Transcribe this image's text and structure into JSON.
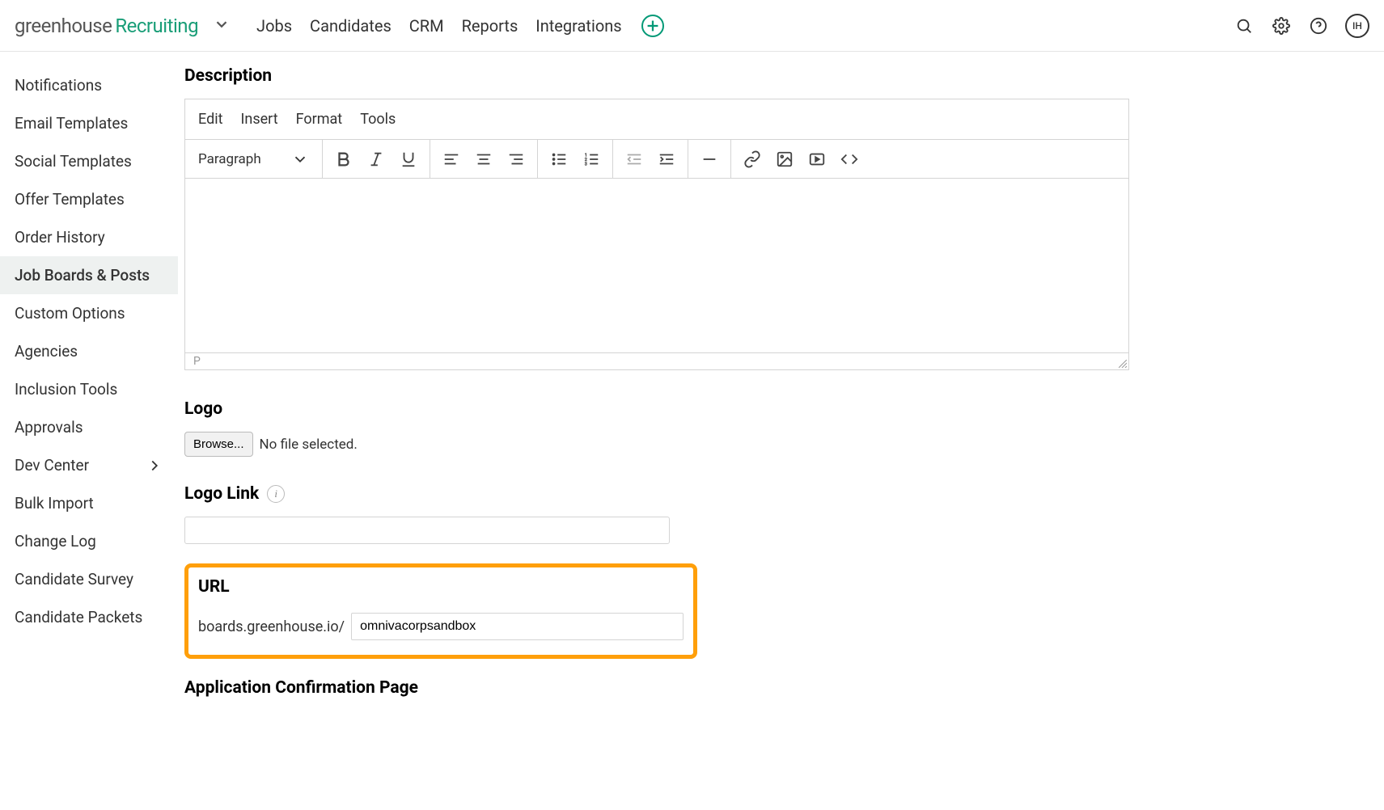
{
  "header": {
    "logo_part1": "greenhouse",
    "logo_part2": "Recruiting",
    "nav": [
      "Jobs",
      "Candidates",
      "CRM",
      "Reports",
      "Integrations"
    ],
    "avatar": "IH"
  },
  "sidebar": {
    "items": [
      {
        "label": "Notifications"
      },
      {
        "label": "Email Templates"
      },
      {
        "label": "Social Templates"
      },
      {
        "label": "Offer Templates"
      },
      {
        "label": "Order History"
      },
      {
        "label": "Job Boards & Posts"
      },
      {
        "label": "Custom Options"
      },
      {
        "label": "Agencies"
      },
      {
        "label": "Inclusion Tools"
      },
      {
        "label": "Approvals"
      },
      {
        "label": "Dev Center"
      },
      {
        "label": "Bulk Import"
      },
      {
        "label": "Change Log"
      },
      {
        "label": "Candidate Survey"
      },
      {
        "label": "Candidate Packets"
      }
    ],
    "active_index": 5,
    "submenu_index": 10
  },
  "main": {
    "description_heading": "Description",
    "editor_menus": [
      "Edit",
      "Insert",
      "Format",
      "Tools"
    ],
    "block_format": "Paragraph",
    "status_path": "P",
    "logo_heading": "Logo",
    "browse_label": "Browse...",
    "no_file_text": "No file selected.",
    "logo_link_heading": "Logo Link",
    "logo_link_value": "",
    "url_heading": "URL",
    "url_prefix": "boards.greenhouse.io/",
    "url_value": "omnivacorpsandbox",
    "confirm_heading": "Application Confirmation Page"
  }
}
